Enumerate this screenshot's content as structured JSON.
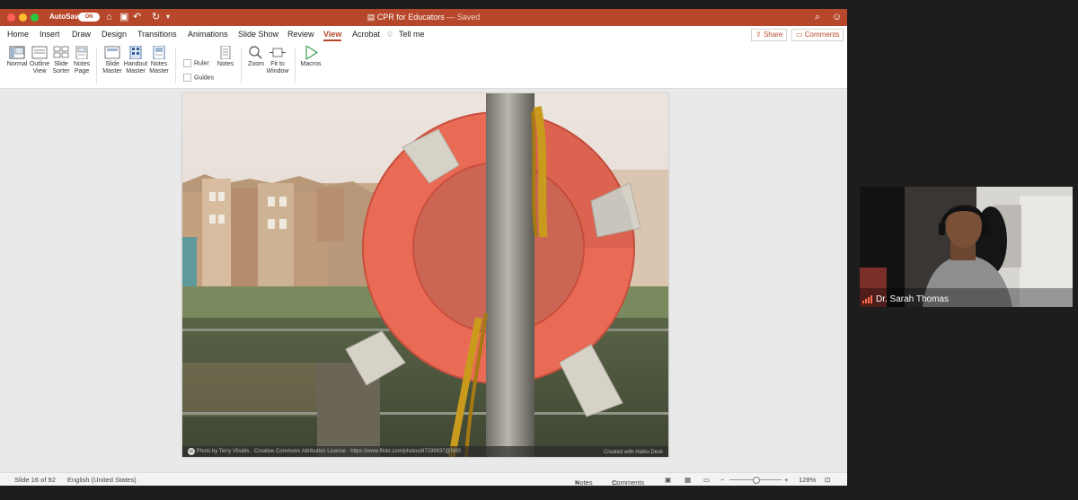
{
  "window": {
    "title": "CPR for Educators",
    "saved_label": "— Saved",
    "autosave_label": "AutoSave",
    "autosave_toggle": "ON"
  },
  "menu": {
    "tabs": [
      "Home",
      "Insert",
      "Draw",
      "Design",
      "Transitions",
      "Animations",
      "Slide Show",
      "Review",
      "View",
      "Acrobat"
    ],
    "active_tab": "View",
    "tell_me": "Tell me",
    "share": "Share",
    "comments": "Comments"
  },
  "ribbon": {
    "normal": "Normal",
    "outline_view": [
      "Outline",
      "View"
    ],
    "slide_sorter": [
      "Slide",
      "Sorter"
    ],
    "notes_page": [
      "Notes",
      "Page"
    ],
    "slide_master": [
      "Slide",
      "Master"
    ],
    "handout_master": [
      "Handout",
      "Master"
    ],
    "notes_master": [
      "Notes",
      "Master"
    ],
    "ruler": "Ruler",
    "guides": "Guides",
    "notes": "Notes",
    "zoom": "Zoom",
    "fit_to_window": [
      "Fit to",
      "Window"
    ],
    "macros": "Macros"
  },
  "slide": {
    "caption_left": "Photo by Terry Vlisidis · Creative Commons Attribution License · https://www.flickr.com/photos/87299937@N00",
    "caption_right": "Created with Haiku Deck",
    "cc_mark": "cc"
  },
  "status": {
    "slide_info": "Slide 16 of 92",
    "language": "English (United States)",
    "notes": "Notes",
    "comments": "Comments",
    "zoom_level": "128%",
    "zoom_minus": "−",
    "zoom_plus": "+"
  },
  "participant": {
    "name": "Dr. Sarah Thomas"
  },
  "colors": {
    "accent": "#b7472a",
    "lifebuoy": "#e96a55"
  }
}
